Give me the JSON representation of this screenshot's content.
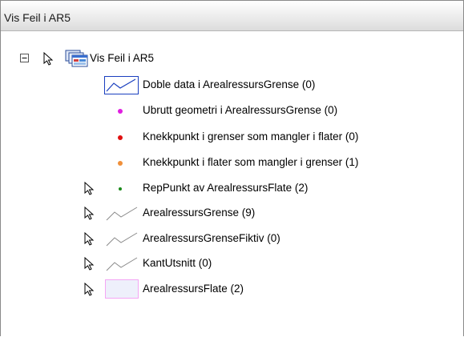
{
  "panel": {
    "title": "Vis Feil i AR5"
  },
  "tree": {
    "root": {
      "label": "Vis Feil i AR5",
      "expander": "minus-box",
      "icon": "layer-group-icon"
    },
    "group_items": [
      {
        "label": "Doble data i ArealressursGrense (0)",
        "symbol": "line-symbol",
        "color": "#1a3fbf"
      },
      {
        "label": "Ubrutt geometri i ArealressursGrense (0)",
        "symbol": "point",
        "color": "#e01ee0"
      },
      {
        "label": "Knekkpunkt i grenser som mangler i flater (0)",
        "symbol": "point",
        "color": "#e01010"
      },
      {
        "label": "Knekkpunkt i flater som mangler i grenser (1)",
        "symbol": "point",
        "color": "#f0903a"
      }
    ],
    "layers": [
      {
        "label": "RepPunkt av ArealressursFlate (2)",
        "symbol": "small-point",
        "color": "#1a8a1a"
      },
      {
        "label": "ArealressursGrense (9)",
        "symbol": "line-symbol",
        "color": "#8a8a8a"
      },
      {
        "label": "ArealressursGrenseFiktiv (0)",
        "symbol": "line-symbol",
        "color": "#8a8a8a"
      },
      {
        "label": "KantUtsnitt (0)",
        "symbol": "line-symbol",
        "color": "#8a8a8a"
      },
      {
        "label": "ArealressursFlate (2)",
        "symbol": "polygon-symbol",
        "color": "#f4a6f4"
      }
    ]
  }
}
